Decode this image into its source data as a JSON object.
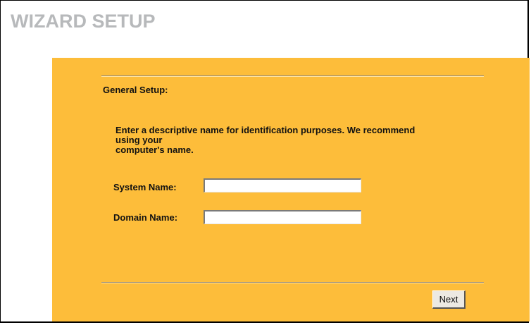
{
  "page": {
    "title": "WIZARD SETUP"
  },
  "section": {
    "heading": "General Setup:"
  },
  "description": {
    "lines": [
      "Enter a descriptive name for identification purposes. We recommend",
      "using your",
      "computer's name."
    ]
  },
  "fields": {
    "system_name": {
      "label": "System Name:",
      "value": ""
    },
    "domain_name": {
      "label": "Domain Name:",
      "value": ""
    }
  },
  "actions": {
    "next_label": "Next"
  },
  "colors": {
    "panel_background": "#fdbd3a",
    "title_text": "#b7b9bb",
    "page_background": "#ffffff"
  }
}
